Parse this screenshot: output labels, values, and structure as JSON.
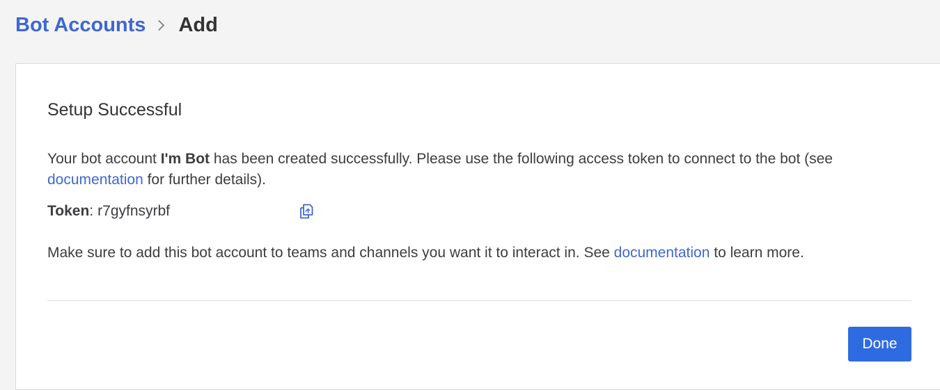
{
  "breadcrumb": {
    "parent": "Bot Accounts",
    "current": "Add"
  },
  "card": {
    "title": "Setup Successful",
    "intro": {
      "prefix": "Your bot account ",
      "bot_name": "I'm Bot",
      "middle": " has been created successfully. Please use the following access token to connect to the bot (see ",
      "link": "documentation",
      "suffix": " for further details)."
    },
    "token": {
      "label": "Token",
      "colon": ": ",
      "value": "r7gyfnsyrbf",
      "copy_icon": "copy-icon"
    },
    "note": {
      "prefix": "Make sure to add this bot account to teams and channels you want it to interact in. See ",
      "link": "documentation",
      "suffix": " to learn more."
    },
    "done_label": "Done"
  },
  "colors": {
    "accent": "#3f67d1",
    "button": "#2f6be0",
    "background": "#f4f4f4"
  }
}
